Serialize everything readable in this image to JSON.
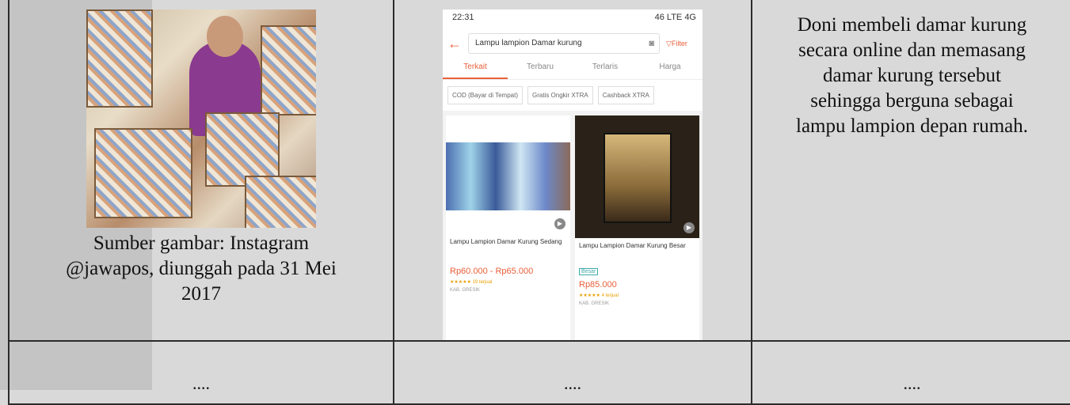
{
  "row1": {
    "caption_lines": [
      "Sumber gambar: Instagram",
      "@jawapos, diunggah pada 31 Mei",
      "2017"
    ],
    "phone": {
      "status_time": "22:31",
      "status_right": "46 LTE 4G",
      "search_text": "Lampu lampion Damar kurung",
      "filter_label": "Filter",
      "tabs": [
        "Terkait",
        "Terbaru",
        "Terlaris",
        "Harga"
      ],
      "chips": [
        "COD (Bayar di Tempat)",
        "Gratis Ongkir XTRA",
        "Cashback XTRA"
      ],
      "products": [
        {
          "title": "Lampu Lampion Damar Kurung Sedang",
          "price": "Rp60.000 - Rp65.000",
          "rating": "19 terjual",
          "location": "KAB. GRESIK"
        },
        {
          "title": "Lampu Lampion Damar Kurung Besar",
          "badge": "Besar",
          "price": "Rp85.000",
          "rating": "4 terjual",
          "location": "KAB. GRESIK"
        }
      ]
    },
    "description_lines": [
      "Doni membeli damar kurung",
      "secara online dan memasang",
      "damar kurung tersebut",
      "sehingga berguna sebagai",
      "lampu lampion depan rumah."
    ]
  },
  "row2": {
    "col1": "....",
    "col2": "....",
    "col3": "...."
  }
}
